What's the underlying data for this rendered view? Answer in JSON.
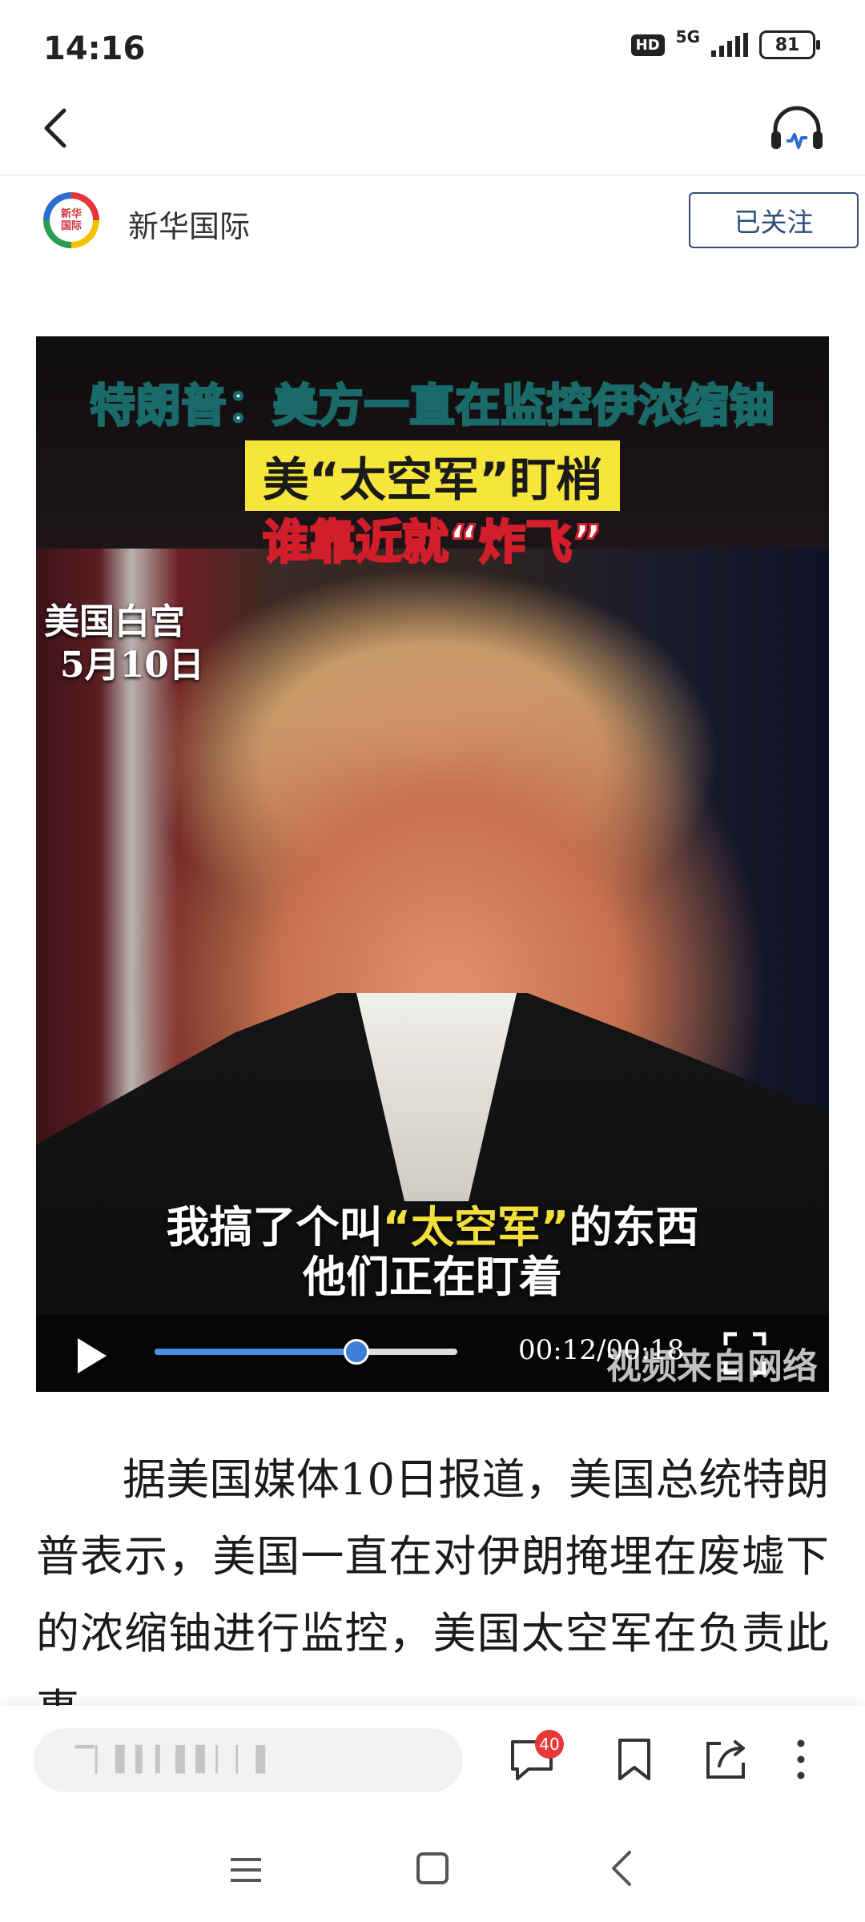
{
  "status_bar": {
    "time": "14:16",
    "hd": "HD",
    "network": "5G",
    "battery": "81"
  },
  "nav": {
    "back_icon": "chevron-left-icon",
    "headphone_icon": "headphone-icon"
  },
  "author": {
    "avatar_text_1": "新华",
    "avatar_text_2": "国际",
    "name": "新华国际",
    "follow_label": "已关注"
  },
  "video": {
    "caption_line1": "特朗普：美方一直在监控伊浓缩铀",
    "caption_line2": "美“太空军”盯梢",
    "caption_line3": "谁靠近就“炸飞”",
    "location": "美国白宫",
    "date": "5月10日",
    "subtitle_line1_pre": "我搞了个叫",
    "subtitle_line1_highlight": "“太空军”",
    "subtitle_line1_post": "的东西",
    "subtitle_line2": "他们正在盯着",
    "time_display": "00:12/00:18",
    "current_time": "00:12",
    "duration": "00:18",
    "progress": 0.667,
    "watermark": "视频来自网络",
    "accent_color": "#4a8ee6"
  },
  "article": {
    "paragraph": "据美国媒体10日报道，美国总统特朗普表示，美国一直在对伊朗掩埋在废墟下的浓缩铀进行监控，美国太空军在负责此事"
  },
  "bottom_bar": {
    "comment_placeholder": "▔▏▌▍▎▌▌▏▏▌",
    "comment_count": "40",
    "badge_color": "#e53935"
  }
}
